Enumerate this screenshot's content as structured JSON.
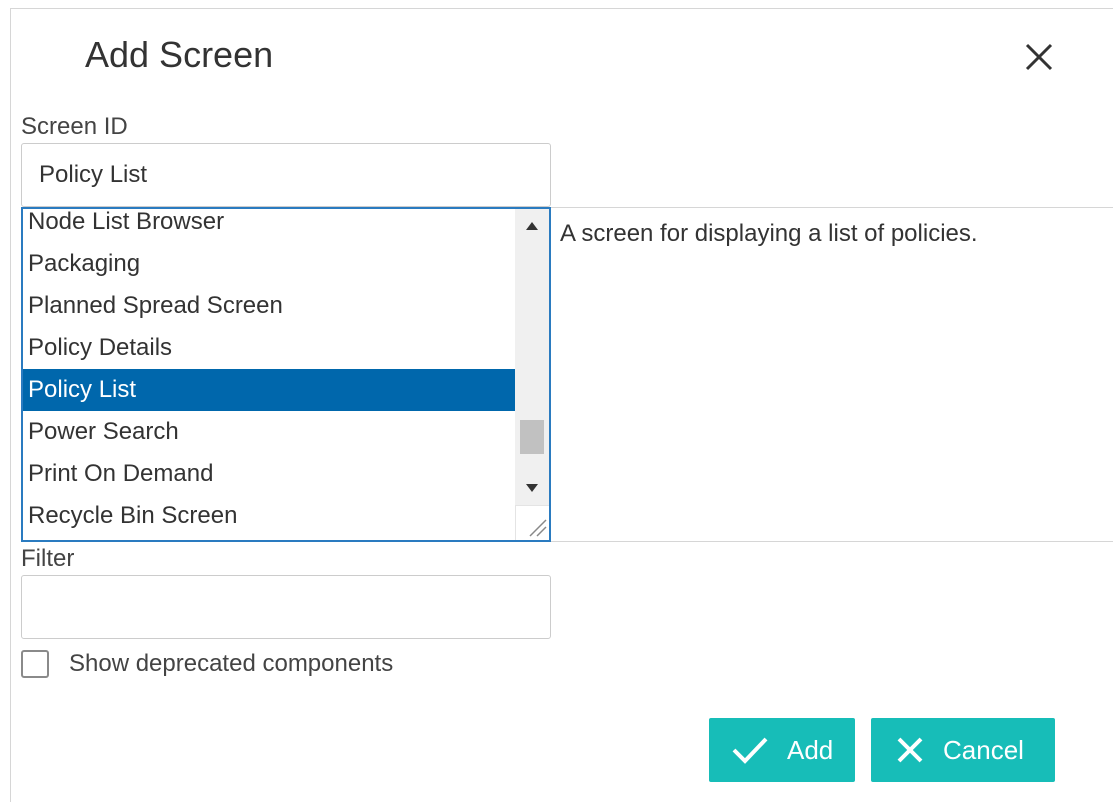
{
  "dialog": {
    "title": "Add Screen",
    "close_icon": "close-icon"
  },
  "screen_id": {
    "label": "Screen ID",
    "value": "Policy List"
  },
  "screen_list": {
    "items": [
      "Node List Browser",
      "Packaging",
      "Planned Spread Screen",
      "Policy Details",
      "Policy List",
      "Power Search",
      "Print On Demand",
      "Recycle Bin Screen"
    ],
    "selected_index": 4,
    "scroll_up_icon": "caret-up-icon",
    "scroll_down_icon": "caret-down-icon",
    "resize_icon": "resize-handle-icon"
  },
  "description": {
    "text": "A screen for displaying a list of policies."
  },
  "filter": {
    "label": "Filter",
    "value": ""
  },
  "deprecated_option": {
    "label": "Show deprecated components",
    "checked": false
  },
  "actions": {
    "add_label": "Add",
    "add_icon": "checkmark-icon",
    "cancel_label": "Cancel",
    "cancel_icon": "x-icon"
  },
  "colors": {
    "accent": "#17bdb8",
    "selection": "#0067ac",
    "list_border": "#2a7bc0"
  }
}
